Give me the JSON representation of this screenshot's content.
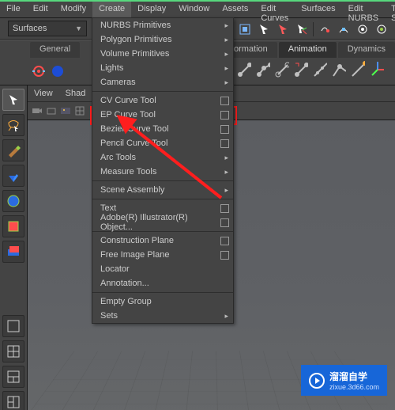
{
  "menubar": [
    "File",
    "Edit",
    "Modify",
    "Create",
    "Display",
    "Window",
    "Assets",
    "Edit Curves",
    "Surfaces",
    "Edit NURBS",
    "The Set"
  ],
  "active_menu_index": 3,
  "mode_combo": "Surfaces",
  "shelf": {
    "tabs": [
      "General",
      "…",
      "…",
      "Deformation",
      "Animation",
      "Dynamics"
    ],
    "active_index": 4
  },
  "panel_menu": [
    "View",
    "Shad"
  ],
  "dropdown": {
    "items": [
      {
        "label": "NURBS Primitives",
        "kind": "sub"
      },
      {
        "label": "Polygon Primitives",
        "kind": "sub"
      },
      {
        "label": "Volume Primitives",
        "kind": "sub"
      },
      {
        "label": "Lights",
        "kind": "sub"
      },
      {
        "label": "Cameras",
        "kind": "sub"
      },
      {
        "kind": "sep"
      },
      {
        "label": "CV Curve Tool",
        "kind": "box"
      },
      {
        "label": "EP Curve Tool",
        "kind": "box",
        "hl": true
      },
      {
        "label": "Bezier Curve Tool",
        "kind": "box"
      },
      {
        "label": "Pencil Curve Tool",
        "kind": "box"
      },
      {
        "label": "Arc Tools",
        "kind": "sub"
      },
      {
        "label": "Measure Tools",
        "kind": "sub"
      },
      {
        "kind": "sep"
      },
      {
        "label": "Scene Assembly",
        "kind": "sub"
      },
      {
        "kind": "sep"
      },
      {
        "label": "Text",
        "kind": "box"
      },
      {
        "label": "Adobe(R) Illustrator(R) Object...",
        "kind": "box"
      },
      {
        "kind": "sep"
      },
      {
        "label": "Construction Plane",
        "kind": "box"
      },
      {
        "label": "Free Image Plane",
        "kind": "box"
      },
      {
        "label": "Locator",
        "kind": ""
      },
      {
        "label": "Annotation...",
        "kind": ""
      },
      {
        "kind": "sep"
      },
      {
        "label": "Empty Group",
        "kind": ""
      },
      {
        "label": "Sets",
        "kind": "sub"
      }
    ]
  },
  "watermark": {
    "title": "溜溜自学",
    "sub": "zixue.3d66.com"
  }
}
